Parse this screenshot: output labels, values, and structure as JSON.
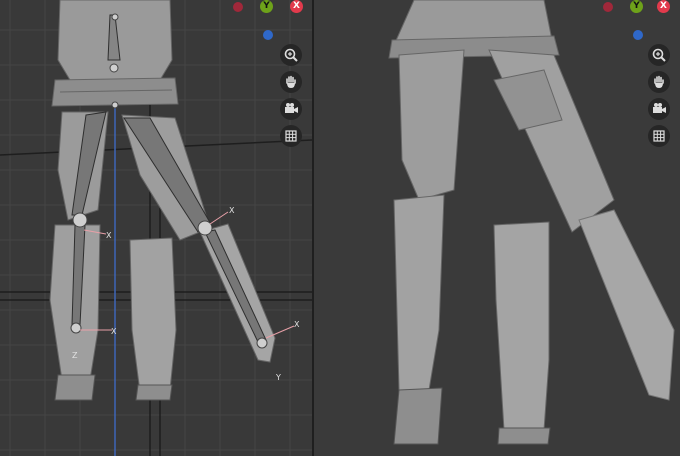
{
  "gizmo_left": {
    "y_label": "Y",
    "x_label": "X",
    "colors": {
      "x": "#e23a4c",
      "y": "#6ea21a",
      "z": "#2f68c9",
      "neg_x": "#a0283a"
    }
  },
  "gizmo_right": {
    "y_label": "Y",
    "x_label": "X"
  },
  "nav_tools": [
    {
      "name": "zoom",
      "icon": "zoom-icon"
    },
    {
      "name": "pan",
      "icon": "hand-icon"
    },
    {
      "name": "camera",
      "icon": "camera-icon"
    },
    {
      "name": "view-grid",
      "icon": "grid-icon"
    }
  ],
  "bone_labels": {
    "x_axis": "X",
    "y_axis": "Y",
    "z_axis": "Z"
  }
}
